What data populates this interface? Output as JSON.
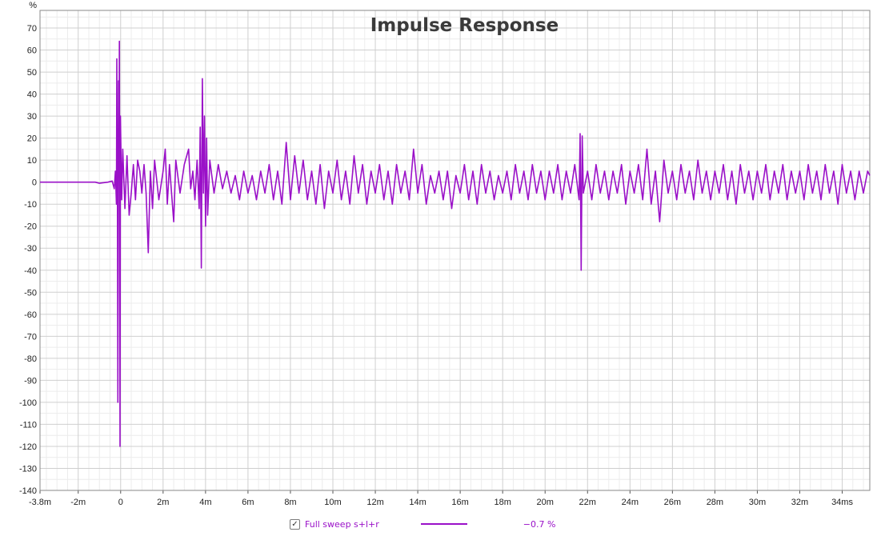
{
  "chart_data": {
    "type": "line",
    "title": "Impulse Response",
    "ylabel": "%",
    "xlabel": "",
    "xlim": [
      -3.8,
      35.3
    ],
    "ylim": [
      -140,
      78
    ],
    "grid": true,
    "x_ticks": [
      {
        "v": -3.8,
        "label": "-3.8m"
      },
      {
        "v": -2,
        "label": "-2m"
      },
      {
        "v": 0,
        "label": "0"
      },
      {
        "v": 2,
        "label": "2m"
      },
      {
        "v": 4,
        "label": "4m"
      },
      {
        "v": 6,
        "label": "6m"
      },
      {
        "v": 8,
        "label": "8m"
      },
      {
        "v": 10,
        "label": "10m"
      },
      {
        "v": 12,
        "label": "12m"
      },
      {
        "v": 14,
        "label": "14m"
      },
      {
        "v": 16,
        "label": "16m"
      },
      {
        "v": 18,
        "label": "18m"
      },
      {
        "v": 20,
        "label": "20m"
      },
      {
        "v": 22,
        "label": "22m"
      },
      {
        "v": 24,
        "label": "24m"
      },
      {
        "v": 26,
        "label": "26m"
      },
      {
        "v": 28,
        "label": "28m"
      },
      {
        "v": 30,
        "label": "30m"
      },
      {
        "v": 32,
        "label": "32m"
      },
      {
        "v": 34,
        "label": "34ms"
      }
    ],
    "y_ticks": [
      70,
      60,
      50,
      40,
      30,
      20,
      10,
      0,
      -10,
      -20,
      -30,
      -40,
      -50,
      -60,
      -70,
      -80,
      -90,
      -100,
      -110,
      -120,
      -130,
      -140
    ],
    "series": [
      {
        "name": "Full sweep s+l+r",
        "legend_value": "−0.7 %",
        "color": "#9a10c8",
        "points": [
          [
            -3.8,
            0
          ],
          [
            -2,
            0
          ],
          [
            -1.2,
            0
          ],
          [
            -1.0,
            -0.5
          ],
          [
            -0.6,
            0
          ],
          [
            -0.4,
            0.5
          ],
          [
            -0.3,
            -3
          ],
          [
            -0.25,
            5
          ],
          [
            -0.2,
            -10
          ],
          [
            -0.18,
            56
          ],
          [
            -0.15,
            -12
          ],
          [
            -0.13,
            -100
          ],
          [
            -0.1,
            46
          ],
          [
            -0.08,
            10
          ],
          [
            -0.06,
            64
          ],
          [
            -0.03,
            -120
          ],
          [
            -0.01,
            30
          ],
          [
            0.05,
            -8
          ],
          [
            0.1,
            15
          ],
          [
            0.2,
            -12
          ],
          [
            0.3,
            12
          ],
          [
            0.4,
            -15
          ],
          [
            0.5,
            -5
          ],
          [
            0.6,
            8
          ],
          [
            0.7,
            -8
          ],
          [
            0.8,
            10
          ],
          [
            0.9,
            5
          ],
          [
            1.0,
            -5
          ],
          [
            1.1,
            8
          ],
          [
            1.2,
            -5
          ],
          [
            1.3,
            -32
          ],
          [
            1.4,
            5
          ],
          [
            1.5,
            -12
          ],
          [
            1.6,
            10
          ],
          [
            1.8,
            -8
          ],
          [
            2.0,
            5
          ],
          [
            2.1,
            15
          ],
          [
            2.2,
            -10
          ],
          [
            2.3,
            8
          ],
          [
            2.4,
            -5
          ],
          [
            2.5,
            -18
          ],
          [
            2.6,
            10
          ],
          [
            2.8,
            -5
          ],
          [
            3.0,
            8
          ],
          [
            3.2,
            15
          ],
          [
            3.3,
            -3
          ],
          [
            3.4,
            5
          ],
          [
            3.5,
            -8
          ],
          [
            3.6,
            10
          ],
          [
            3.7,
            -12
          ],
          [
            3.75,
            25
          ],
          [
            3.8,
            -39
          ],
          [
            3.85,
            47
          ],
          [
            3.9,
            -5
          ],
          [
            3.95,
            30
          ],
          [
            4.0,
            -20
          ],
          [
            4.05,
            20
          ],
          [
            4.1,
            -15
          ],
          [
            4.2,
            10
          ],
          [
            4.4,
            -5
          ],
          [
            4.6,
            8
          ],
          [
            4.8,
            -3
          ],
          [
            5.0,
            5
          ],
          [
            5.2,
            -5
          ],
          [
            5.4,
            3
          ],
          [
            5.6,
            -8
          ],
          [
            5.8,
            5
          ],
          [
            6.0,
            -5
          ],
          [
            6.2,
            3
          ],
          [
            6.4,
            -8
          ],
          [
            6.6,
            5
          ],
          [
            6.8,
            -5
          ],
          [
            7.0,
            8
          ],
          [
            7.2,
            -8
          ],
          [
            7.4,
            5
          ],
          [
            7.6,
            -10
          ],
          [
            7.8,
            18
          ],
          [
            8.0,
            -8
          ],
          [
            8.2,
            12
          ],
          [
            8.4,
            -5
          ],
          [
            8.6,
            10
          ],
          [
            8.8,
            -8
          ],
          [
            9.0,
            5
          ],
          [
            9.2,
            -10
          ],
          [
            9.4,
            8
          ],
          [
            9.6,
            -12
          ],
          [
            9.8,
            5
          ],
          [
            10.0,
            -5
          ],
          [
            10.2,
            10
          ],
          [
            10.4,
            -8
          ],
          [
            10.6,
            5
          ],
          [
            10.8,
            -10
          ],
          [
            11.0,
            12
          ],
          [
            11.2,
            -5
          ],
          [
            11.4,
            8
          ],
          [
            11.6,
            -10
          ],
          [
            11.8,
            5
          ],
          [
            12.0,
            -5
          ],
          [
            12.2,
            8
          ],
          [
            12.4,
            -8
          ],
          [
            12.6,
            5
          ],
          [
            12.8,
            -10
          ],
          [
            13.0,
            8
          ],
          [
            13.2,
            -5
          ],
          [
            13.4,
            5
          ],
          [
            13.6,
            -8
          ],
          [
            13.8,
            15
          ],
          [
            14.0,
            -5
          ],
          [
            14.2,
            8
          ],
          [
            14.4,
            -10
          ],
          [
            14.6,
            3
          ],
          [
            14.8,
            -5
          ],
          [
            15.0,
            5
          ],
          [
            15.2,
            -8
          ],
          [
            15.4,
            5
          ],
          [
            15.6,
            -12
          ],
          [
            15.8,
            3
          ],
          [
            16.0,
            -5
          ],
          [
            16.2,
            8
          ],
          [
            16.4,
            -8
          ],
          [
            16.6,
            5
          ],
          [
            16.8,
            -10
          ],
          [
            17.0,
            8
          ],
          [
            17.2,
            -5
          ],
          [
            17.4,
            5
          ],
          [
            17.6,
            -8
          ],
          [
            17.8,
            3
          ],
          [
            18.0,
            -5
          ],
          [
            18.2,
            5
          ],
          [
            18.4,
            -8
          ],
          [
            18.6,
            8
          ],
          [
            18.8,
            -5
          ],
          [
            19.0,
            5
          ],
          [
            19.2,
            -8
          ],
          [
            19.4,
            8
          ],
          [
            19.6,
            -5
          ],
          [
            19.8,
            5
          ],
          [
            20.0,
            -8
          ],
          [
            20.2,
            5
          ],
          [
            20.4,
            -5
          ],
          [
            20.6,
            8
          ],
          [
            20.8,
            -8
          ],
          [
            21.0,
            5
          ],
          [
            21.2,
            -5
          ],
          [
            21.4,
            8
          ],
          [
            21.6,
            -8
          ],
          [
            21.65,
            22
          ],
          [
            21.7,
            -40
          ],
          [
            21.75,
            21
          ],
          [
            21.8,
            -5
          ],
          [
            22.0,
            5
          ],
          [
            22.2,
            -8
          ],
          [
            22.4,
            8
          ],
          [
            22.6,
            -5
          ],
          [
            22.8,
            5
          ],
          [
            23.0,
            -8
          ],
          [
            23.2,
            5
          ],
          [
            23.4,
            -5
          ],
          [
            23.6,
            8
          ],
          [
            23.8,
            -10
          ],
          [
            24.0,
            5
          ],
          [
            24.2,
            -5
          ],
          [
            24.4,
            8
          ],
          [
            24.6,
            -8
          ],
          [
            24.8,
            15
          ],
          [
            25.0,
            -10
          ],
          [
            25.2,
            5
          ],
          [
            25.4,
            -18
          ],
          [
            25.6,
            10
          ],
          [
            25.8,
            -5
          ],
          [
            26.0,
            5
          ],
          [
            26.2,
            -8
          ],
          [
            26.4,
            8
          ],
          [
            26.6,
            -5
          ],
          [
            26.8,
            5
          ],
          [
            27.0,
            -8
          ],
          [
            27.2,
            10
          ],
          [
            27.4,
            -5
          ],
          [
            27.6,
            5
          ],
          [
            27.8,
            -8
          ],
          [
            28.0,
            5
          ],
          [
            28.2,
            -5
          ],
          [
            28.4,
            8
          ],
          [
            28.6,
            -8
          ],
          [
            28.8,
            5
          ],
          [
            29.0,
            -10
          ],
          [
            29.2,
            8
          ],
          [
            29.4,
            -5
          ],
          [
            29.6,
            5
          ],
          [
            29.8,
            -8
          ],
          [
            30.0,
            5
          ],
          [
            30.2,
            -5
          ],
          [
            30.4,
            8
          ],
          [
            30.6,
            -8
          ],
          [
            30.8,
            5
          ],
          [
            31.0,
            -5
          ],
          [
            31.2,
            8
          ],
          [
            31.4,
            -8
          ],
          [
            31.6,
            5
          ],
          [
            31.8,
            -5
          ],
          [
            32.0,
            5
          ],
          [
            32.2,
            -8
          ],
          [
            32.4,
            8
          ],
          [
            32.6,
            -5
          ],
          [
            32.8,
            5
          ],
          [
            33.0,
            -8
          ],
          [
            33.2,
            8
          ],
          [
            33.4,
            -5
          ],
          [
            33.6,
            5
          ],
          [
            33.8,
            -10
          ],
          [
            34.0,
            8
          ],
          [
            34.2,
            -5
          ],
          [
            34.4,
            5
          ],
          [
            34.6,
            -8
          ],
          [
            34.8,
            5
          ],
          [
            35.0,
            -5
          ],
          [
            35.2,
            5
          ],
          [
            35.3,
            3
          ]
        ]
      }
    ]
  },
  "legend": {
    "checkbox_mark": "✓"
  }
}
